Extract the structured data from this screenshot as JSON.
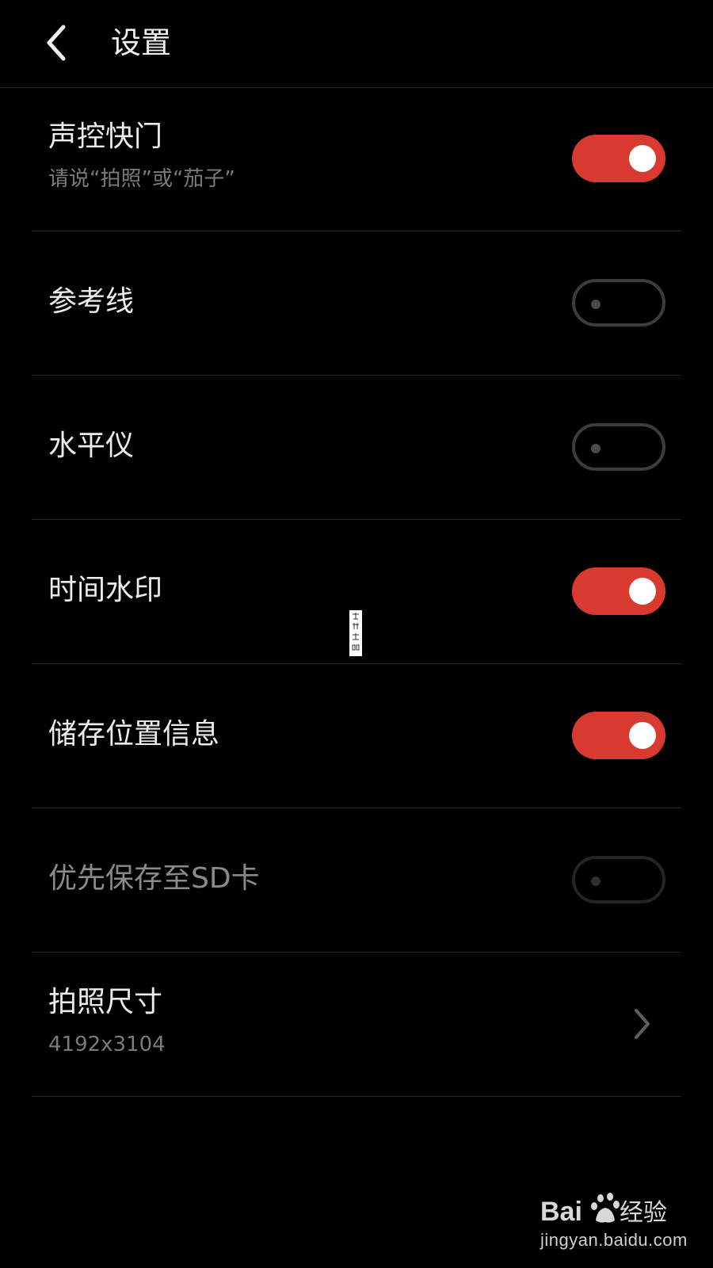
{
  "header": {
    "title": "设置",
    "back_icon": "chevron-left-icon"
  },
  "settings": [
    {
      "label": "声控快门",
      "sublabel": "请说“拍照”或“茄子”",
      "control": "toggle",
      "on": true,
      "enabled": true
    },
    {
      "label": "参考线",
      "control": "toggle",
      "on": false,
      "enabled": true
    },
    {
      "label": "水平仪",
      "control": "toggle",
      "on": false,
      "enabled": true
    },
    {
      "label": "时间水印",
      "control": "toggle",
      "on": true,
      "enabled": true
    },
    {
      "label": "储存位置信息",
      "control": "toggle",
      "on": true,
      "enabled": true
    },
    {
      "label": "优先保存至SD卡",
      "control": "toggle",
      "on": false,
      "enabled": false
    },
    {
      "label": "拍照尺寸",
      "sublabel": "4192x3104",
      "control": "chevron",
      "icon": "chevron-right-icon"
    }
  ],
  "colors": {
    "accent": "#d93a2f",
    "background": "#000000",
    "text": "#ececec",
    "subtext": "#7a7a7a",
    "divider": "#262626"
  },
  "watermark": {
    "brand": "Baidu经验",
    "url": "jingyan.baidu.com"
  }
}
